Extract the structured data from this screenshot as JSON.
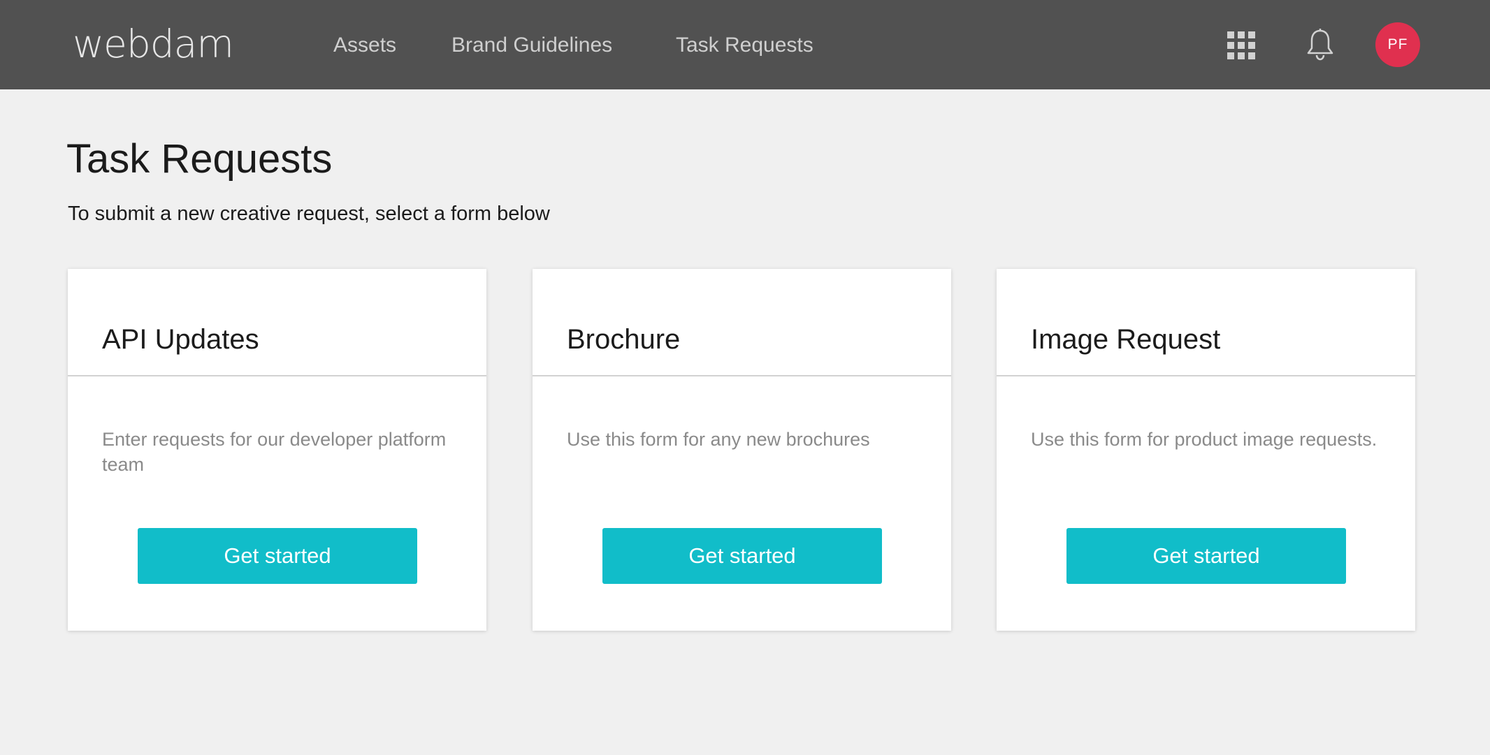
{
  "header": {
    "logo_text": "webdam",
    "nav": [
      {
        "label": "Assets"
      },
      {
        "label": "Brand Guidelines"
      },
      {
        "label": "Task Requests"
      }
    ],
    "icons": {
      "apps": "apps-grid-icon",
      "notifications": "bell-icon"
    },
    "avatar_initials": "PF",
    "colors": {
      "bar": "#515151",
      "avatar": "#e0304f"
    }
  },
  "main": {
    "title": "Task Requests",
    "subtitle": "To submit a new creative request, select a form below",
    "cards": [
      {
        "title": "API Updates",
        "description": "Enter requests for our developer platform team",
        "button": "Get started"
      },
      {
        "title": "Brochure",
        "description": "Use this form for any new brochures",
        "button": "Get started"
      },
      {
        "title": "Image Request",
        "description": "Use this form for product image requests.",
        "button": "Get started"
      }
    ],
    "colors": {
      "button": "#11bdc9",
      "description": "#8a8a8a"
    }
  }
}
